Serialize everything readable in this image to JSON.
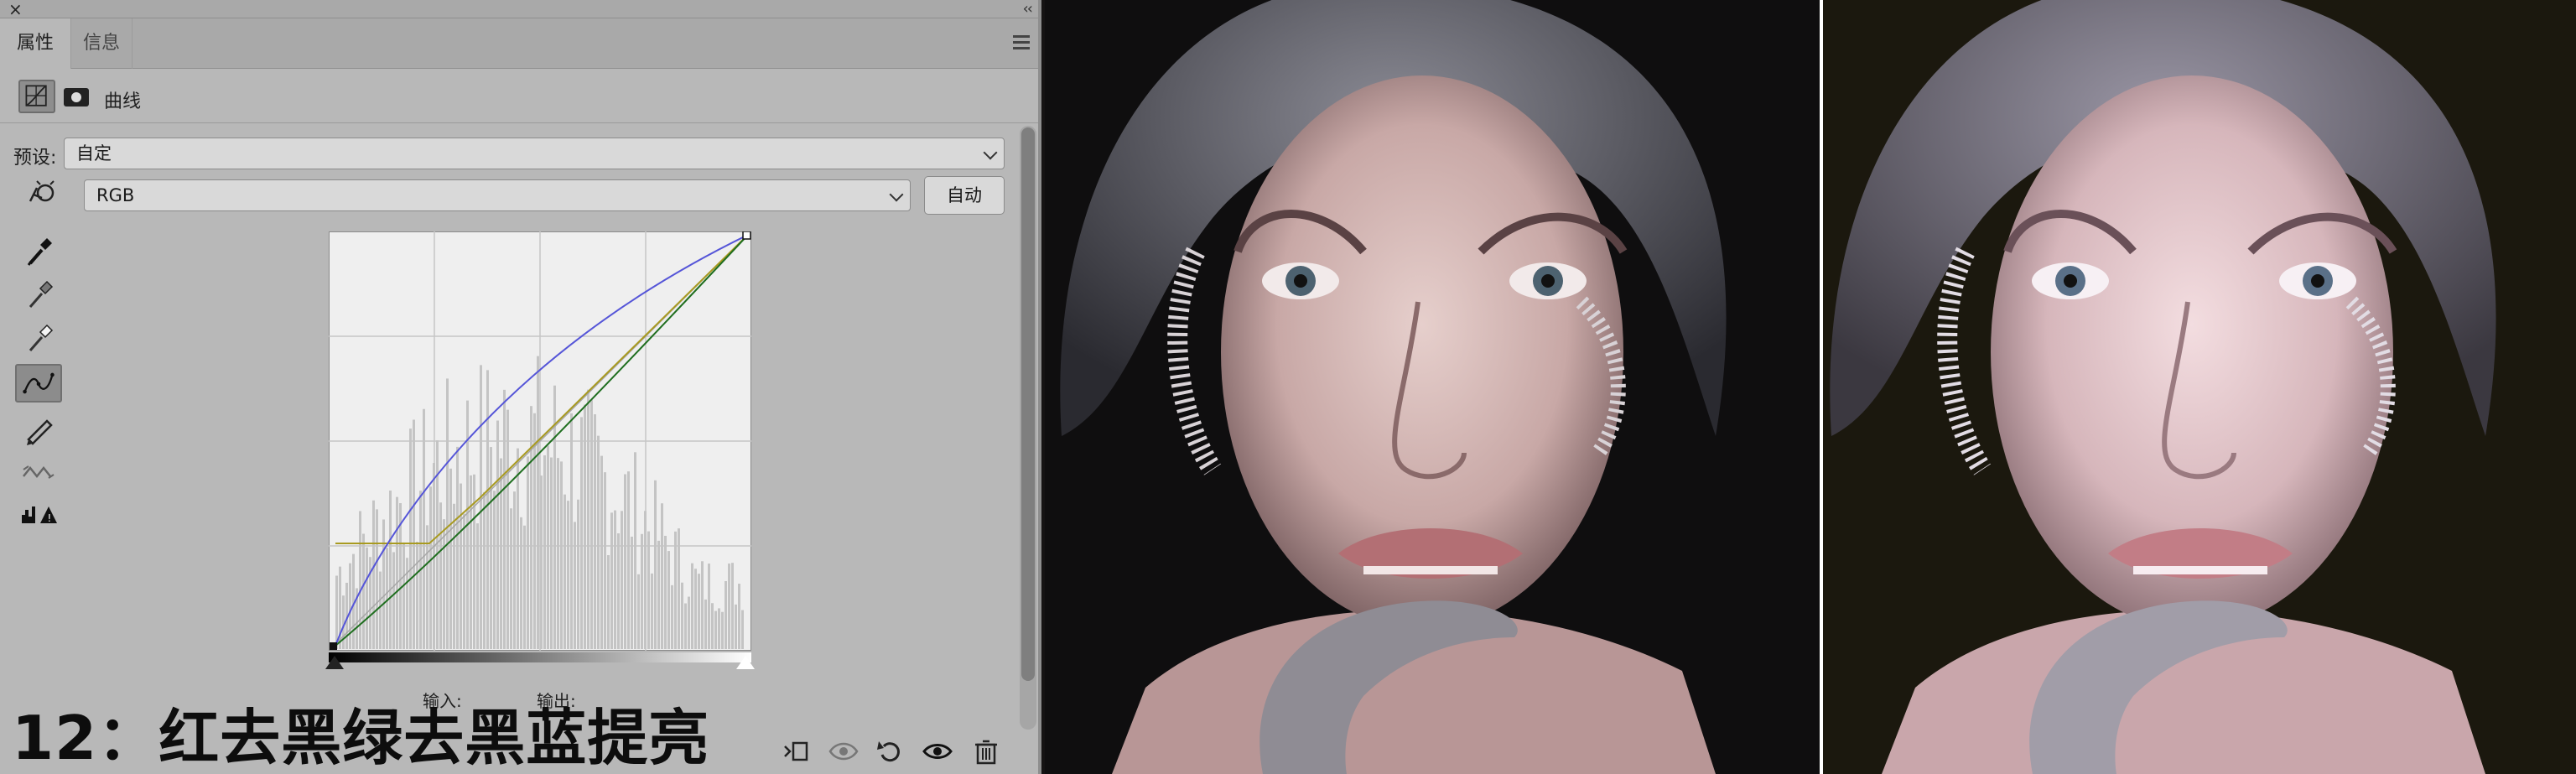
{
  "panel": {
    "tabs": [
      {
        "label": "属性",
        "active": true
      },
      {
        "label": "信息",
        "active": false
      }
    ],
    "adjustment_label": "曲线",
    "preset_label": "预设:",
    "preset_value": "自定",
    "channel_value": "RGB",
    "auto_label": "自动",
    "input_label": "输入:",
    "output_label": "输出:",
    "tools": [
      "targeted-adjust-icon",
      "black-eyedropper-icon",
      "gray-eyedropper-icon",
      "white-eyedropper-icon",
      "curve-edit-icon",
      "pencil-icon",
      "smooth-icon",
      "clipping-warning-icon"
    ],
    "bottom_icons": [
      "clip-to-layer-icon",
      "view-previous-icon",
      "reset-icon",
      "visibility-eye-icon",
      "trash-icon"
    ]
  },
  "caption": "12：红去黑绿去黑蓝提亮",
  "curves": {
    "blue_curve_color": "#5555d8",
    "green_curve_color": "#1f6e1f",
    "red_curve_color": "#a89a20"
  },
  "colors": {
    "panel_bg": "#b8b8b8",
    "graph_bg": "#efefef",
    "before_bg": "#0f0e0f",
    "after_bg": "#1b180e"
  }
}
